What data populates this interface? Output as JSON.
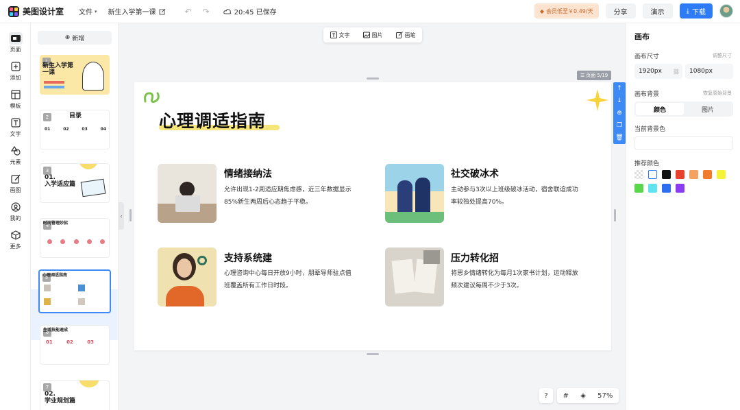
{
  "app": {
    "name": "美图设计室"
  },
  "menu": {
    "file_label": "文件"
  },
  "document": {
    "title": "新生入学第一课",
    "save_time": "20:45 已保存"
  },
  "topbar": {
    "vip_label": "会员低至￥0.49/天",
    "share_label": "分享",
    "present_label": "演示",
    "download_label": "下载"
  },
  "rail": {
    "items": [
      {
        "label": "页面",
        "icon": "pages-icon"
      },
      {
        "label": "添加",
        "icon": "add-icon"
      },
      {
        "label": "模板",
        "icon": "template-icon"
      },
      {
        "label": "文字",
        "icon": "text-icon"
      },
      {
        "label": "元素",
        "icon": "elements-icon"
      },
      {
        "label": "画图",
        "icon": "draw-icon"
      },
      {
        "label": "我的",
        "icon": "user-icon"
      },
      {
        "label": "更多",
        "icon": "more-icon"
      }
    ]
  },
  "thumbs": {
    "new_label": "新增",
    "items": [
      {
        "num": "1",
        "title": "新生入学第一课"
      },
      {
        "num": "2",
        "title": "目录",
        "cols": [
          "01",
          "02",
          "03",
          "04"
        ]
      },
      {
        "num": "3",
        "title": "01.\n入学适应篇"
      },
      {
        "num": "4",
        "title": "时间管理妙招"
      },
      {
        "num": "5",
        "title": "心理调适指南"
      },
      {
        "num": "6",
        "title": "生活技能速成",
        "cols": [
          "01",
          "02",
          "03"
        ]
      },
      {
        "num": "7",
        "title": "02.\n学业规划篇"
      }
    ]
  },
  "float_toolbar": {
    "text_label": "文字",
    "image_label": "图片",
    "pen_label": "画笔"
  },
  "canvas": {
    "page_indicator": "页面 5/19",
    "zoom": "57%"
  },
  "slide": {
    "title": "心理调适指南",
    "cards": [
      {
        "heading": "情绪接纳法",
        "body": [
          "允许出现1-2周适应期焦虑感，近三年数据显示",
          "85%新生两周后心态趋于平稳。"
        ]
      },
      {
        "heading": "社交破冰术",
        "body": [
          "主动参与3次以上班级破冰活动，宿舍联谊成功",
          "率较独处提高70%。"
        ]
      },
      {
        "heading": "支持系统建",
        "body": [
          "心理咨询中心每日开放9小时，朋辈导师驻点值",
          "班覆盖所有工作日时段。"
        ]
      },
      {
        "heading": "压力转化招",
        "body": [
          "将思乡情绪转化为每月1次家书计划，运动释放",
          "频次建议每周不少于3次。"
        ]
      }
    ]
  },
  "right_panel": {
    "title": "画布",
    "size_label": "画布尺寸",
    "resize_link": "调整尺寸",
    "width_value": "1920px",
    "height_value": "1080px",
    "bg_label": "画布背景",
    "reset_bg_link": "恢复原始背景",
    "tab_color": "颜色",
    "tab_image": "图片",
    "current_bg_label": "当前背景色",
    "recommend_label": "推荐颜色",
    "swatches": [
      "transparent",
      "#ffffff",
      "#111111",
      "#e8412c",
      "#f4a261",
      "#f07c2c",
      "#f5f23a",
      "#59d64b",
      "#5fe3f0",
      "#2d6ef0",
      "#8a3df0"
    ]
  },
  "colors": {
    "accent": "#2d7cf6",
    "selection": "#3d8af7"
  }
}
